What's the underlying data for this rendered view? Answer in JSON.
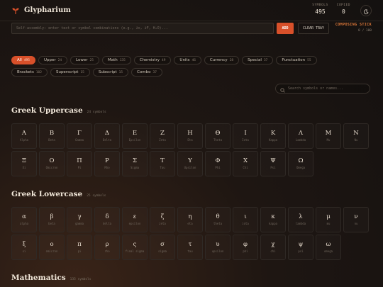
{
  "app": {
    "title": "Glypharium",
    "logo_icon": "sprout-icon"
  },
  "stats": [
    {
      "label": "SYMBOLS",
      "value": "495"
    },
    {
      "label": "COPIED",
      "value": "0"
    }
  ],
  "theme_toggle": {
    "icon": "moon-icon"
  },
  "composer": {
    "placeholder": "Self-assembly: enter text or symbol combinations (e.g., ∂x, ∂F, H₂O)...",
    "add_label": "ADD",
    "clear_label": "CLEAR TRAY",
    "status_label": "COMPOSING STICK",
    "status_count": "0 / 100"
  },
  "filters": {
    "row1": [
      {
        "label": "All",
        "count": "495",
        "active": true
      },
      {
        "label": "Upper",
        "count": "24"
      },
      {
        "label": "Lower",
        "count": "25"
      },
      {
        "label": "Math",
        "count": "135"
      },
      {
        "label": "Chemistry",
        "count": "49"
      },
      {
        "label": "Units",
        "count": "46"
      },
      {
        "label": "Currency",
        "count": "28"
      },
      {
        "label": "Special",
        "count": "37"
      },
      {
        "label": "Punctuation",
        "count": "55"
      }
    ],
    "row2": [
      {
        "label": "Brackets",
        "count": "102"
      },
      {
        "label": "Superscript",
        "count": "15"
      },
      {
        "label": "Subscript",
        "count": "15"
      },
      {
        "label": "Combo",
        "count": "37"
      }
    ]
  },
  "search": {
    "placeholder": "Search symbols or names...",
    "icon": "search-icon"
  },
  "sections": [
    {
      "title": "Greek Uppercase",
      "count": "24 symbols",
      "symbols": [
        {
          "glyph": "Α",
          "name": "Alpha"
        },
        {
          "glyph": "Β",
          "name": "Beta"
        },
        {
          "glyph": "Γ",
          "name": "Gamma"
        },
        {
          "glyph": "Δ",
          "name": "Delta"
        },
        {
          "glyph": "Ε",
          "name": "Epsilon"
        },
        {
          "glyph": "Ζ",
          "name": "Zeta"
        },
        {
          "glyph": "Η",
          "name": "Eta"
        },
        {
          "glyph": "Θ",
          "name": "Theta"
        },
        {
          "glyph": "Ι",
          "name": "Iota"
        },
        {
          "glyph": "Κ",
          "name": "Kappa"
        },
        {
          "glyph": "Λ",
          "name": "Lambda"
        },
        {
          "glyph": "Μ",
          "name": "Mu"
        },
        {
          "glyph": "Ν",
          "name": "Nu"
        },
        {
          "glyph": "Ξ",
          "name": "Xi"
        },
        {
          "glyph": "Ο",
          "name": "Omicron"
        },
        {
          "glyph": "Π",
          "name": "Pi"
        },
        {
          "glyph": "Ρ",
          "name": "Rho"
        },
        {
          "glyph": "Σ",
          "name": "Sigma"
        },
        {
          "glyph": "Τ",
          "name": "Tau"
        },
        {
          "glyph": "Υ",
          "name": "Upsilon"
        },
        {
          "glyph": "Φ",
          "name": "Phi"
        },
        {
          "glyph": "Χ",
          "name": "Chi"
        },
        {
          "glyph": "Ψ",
          "name": "Psi"
        },
        {
          "glyph": "Ω",
          "name": "Omega"
        }
      ]
    },
    {
      "title": "Greek Lowercase",
      "count": "25 symbols",
      "symbols": [
        {
          "glyph": "α",
          "name": "alpha"
        },
        {
          "glyph": "β",
          "name": "beta"
        },
        {
          "glyph": "γ",
          "name": "gamma"
        },
        {
          "glyph": "δ",
          "name": "delta"
        },
        {
          "glyph": "ε",
          "name": "epsilon"
        },
        {
          "glyph": "ζ",
          "name": "zeta"
        },
        {
          "glyph": "η",
          "name": "eta"
        },
        {
          "glyph": "θ",
          "name": "theta"
        },
        {
          "glyph": "ι",
          "name": "iota"
        },
        {
          "glyph": "κ",
          "name": "kappa"
        },
        {
          "glyph": "λ",
          "name": "lambda"
        },
        {
          "glyph": "μ",
          "name": "mu"
        },
        {
          "glyph": "ν",
          "name": "nu"
        },
        {
          "glyph": "ξ",
          "name": "xi"
        },
        {
          "glyph": "ο",
          "name": "omicron"
        },
        {
          "glyph": "π",
          "name": "pi"
        },
        {
          "glyph": "ρ",
          "name": "rho"
        },
        {
          "glyph": "ς",
          "name": "final sigma"
        },
        {
          "glyph": "σ",
          "name": "sigma"
        },
        {
          "glyph": "τ",
          "name": "tau"
        },
        {
          "glyph": "υ",
          "name": "upsilon"
        },
        {
          "glyph": "φ",
          "name": "phi"
        },
        {
          "glyph": "χ",
          "name": "chi"
        },
        {
          "glyph": "ψ",
          "name": "psi"
        },
        {
          "glyph": "ω",
          "name": "omega"
        }
      ]
    },
    {
      "title": "Mathematics",
      "count": "135 symbols",
      "symbols": []
    }
  ],
  "colors": {
    "accent": "#d8502a",
    "background": "#1a1512",
    "text": "#d8cfc2"
  }
}
